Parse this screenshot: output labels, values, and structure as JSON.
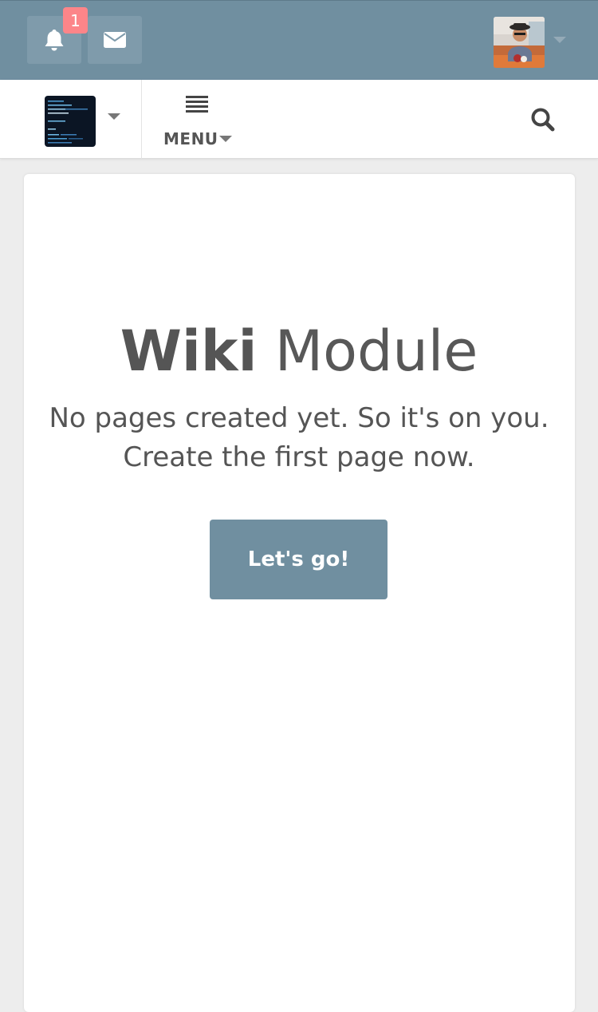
{
  "topbar": {
    "notifications": {
      "icon": "bell-icon",
      "badge_count": "1"
    },
    "messages": {
      "icon": "envelope-icon"
    },
    "user": {
      "avatar": "user-avatar"
    },
    "colors": {
      "bar": "#708fa0",
      "button": "#7f9bab",
      "badge": "#fc8589"
    }
  },
  "navbar": {
    "space": {
      "image": "space-avatar"
    },
    "menu": {
      "icon": "hamburger-icon",
      "label": "MENU"
    },
    "search": {
      "icon": "search-icon"
    }
  },
  "main": {
    "title_bold": "Wiki",
    "title_light": "Module",
    "subtitle_line1": "No pages created yet. So it's on you.",
    "subtitle_line2": "Create the first page now.",
    "cta_label": "Let's go!"
  }
}
